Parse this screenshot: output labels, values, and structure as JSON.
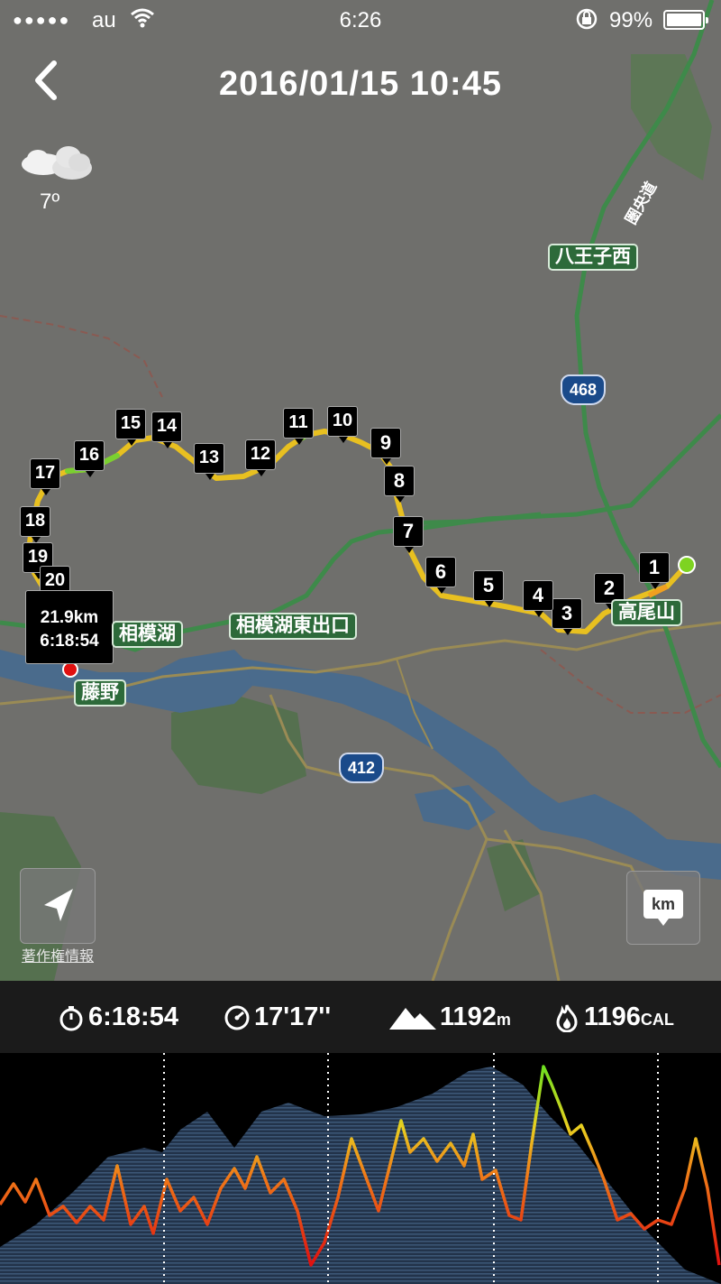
{
  "status_bar": {
    "signal": "●●●●●",
    "carrier": "au",
    "time": "6:26",
    "battery": "99%"
  },
  "header": {
    "title": "2016/01/15  10:45"
  },
  "weather": {
    "temperature": "7º",
    "icon": "cloud-icon"
  },
  "map": {
    "place_labels": {
      "hachiojinishi": "八王子西",
      "takaosan": "高尾山",
      "sagamiko": "相模湖",
      "sagamiko_higashi": "相模湖東出口",
      "fujino": "藤野",
      "kenodo": "圏央道"
    },
    "route_shields": [
      "468",
      "412"
    ],
    "km_markers": [
      "1",
      "2",
      "3",
      "4",
      "5",
      "6",
      "7",
      "8",
      "9",
      "10",
      "11",
      "12",
      "13",
      "14",
      "15",
      "16",
      "17",
      "18",
      "19",
      "20"
    ],
    "end_callout": {
      "distance": "21.9km",
      "duration": "6:18:54"
    },
    "copyright_link": "著作権情報",
    "unit_button": "km",
    "colors": {
      "route_slow": "#f0a020",
      "route_mid": "#e8e020",
      "route_fast": "#7ad030",
      "start_dot": "#7ed321",
      "end_dot": "#e01010"
    }
  },
  "stats": {
    "time": "6:18:54",
    "pace": "17'17''",
    "elevation_value": "1192",
    "elevation_unit": "m",
    "calories_value": "1196",
    "calories_unit": "CAL"
  },
  "graph": {
    "split_markers": 4
  }
}
